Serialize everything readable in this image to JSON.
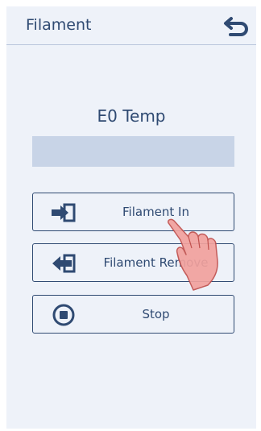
{
  "header": {
    "title": "Filament",
    "back_icon": "return-arrow-icon"
  },
  "temperature": {
    "label": "E0 Temp"
  },
  "buttons": {
    "filament_in": {
      "label": "Filament In",
      "icon": "filament-in-icon"
    },
    "filament_remove": {
      "label": "Filament Remove",
      "icon": "filament-out-icon"
    },
    "stop": {
      "label": "Stop",
      "icon": "stop-icon"
    }
  },
  "colors": {
    "accent": "#2f4a72",
    "panel": "#eef2f9",
    "bar": "#c8d4e7",
    "pointer": "#f08c88"
  }
}
